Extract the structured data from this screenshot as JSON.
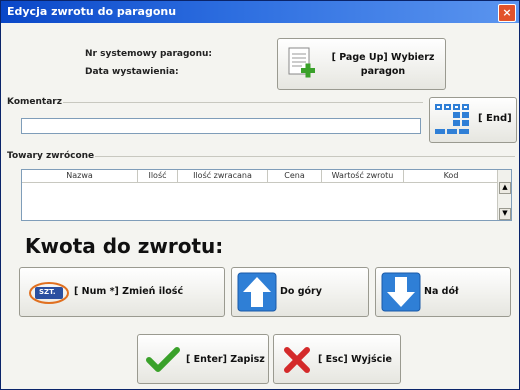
{
  "window": {
    "title": "Edycja zwrotu do paragonu",
    "close_label": "×"
  },
  "header": {
    "receipt_number_label": "Nr systemowy paragonu:",
    "date_label": "Data wystawienia:",
    "select_receipt_button": {
      "line1": "[ Page Up] Wybierz",
      "line2": "paragon"
    }
  },
  "comment": {
    "label": "Komentarz",
    "value": "",
    "keyboard_button": "[ End]"
  },
  "returned_items": {
    "label": "Towary zwrócone",
    "columns": [
      "Nazwa",
      "Ilość",
      "Ilość zwracana",
      "Cena",
      "Wartość zwrotu",
      "Kod"
    ],
    "rows": []
  },
  "amount": {
    "label": "Kwota do zwrotu:"
  },
  "actions": {
    "change_qty": {
      "badge": "SZT.",
      "label": "[ Num *] Zmień ilość"
    },
    "up": {
      "label": "Do góry"
    },
    "down": {
      "label": "Na dół"
    }
  },
  "footer": {
    "save": "[ Enter] Zapisz",
    "exit": "[ Esc] Wyjście"
  },
  "colors": {
    "title_bar": "#0a47c8",
    "accent_blue": "#2f7fd6",
    "check_green": "#3aa12a",
    "cross_red": "#d42a2a"
  }
}
